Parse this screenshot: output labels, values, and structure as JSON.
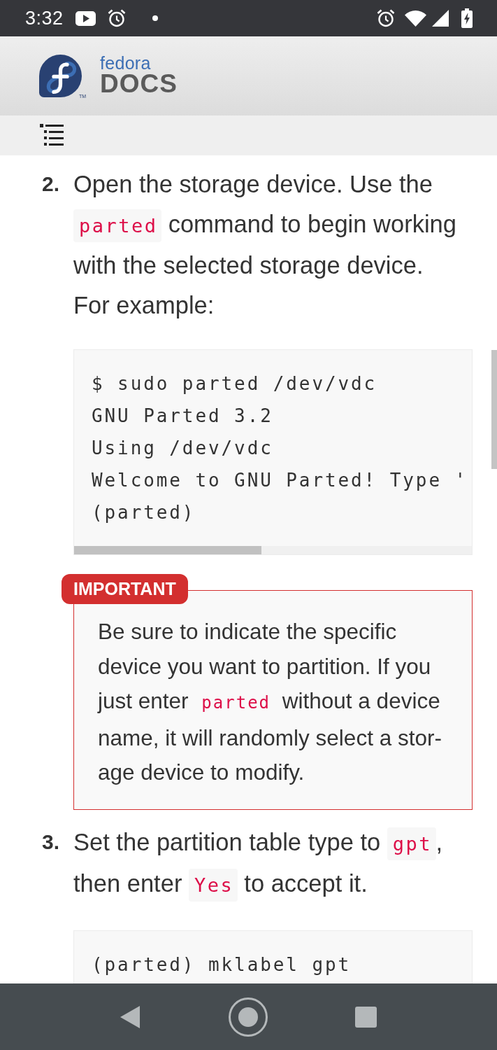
{
  "status_bar": {
    "time": "3:32"
  },
  "header": {
    "logo_wordmark": "fedora",
    "logo_title": "DOCS",
    "trademark": "TM"
  },
  "steps": [
    {
      "number": "2.",
      "text": [
        {
          "kind": "text",
          "value": "Open the storage device. Use the "
        },
        {
          "kind": "code",
          "value": "parted"
        },
        {
          "kind": "text",
          "value": " command to begin working with the selected storage device. For example:"
        }
      ],
      "code_block": {
        "lines": [
          "$ sudo parted /dev/vdc",
          "GNU Parted 3.2",
          "Using /dev/vdc",
          "Welcome to GNU Parted! Type '",
          "(parted)"
        ],
        "scrollbar": true
      },
      "admonition": {
        "kind": "important",
        "label": "IMPORTANT",
        "text": [
          {
            "kind": "text",
            "value": "Be sure to indicate the specific device you want to partition. If you just enter "
          },
          {
            "kind": "code",
            "value": "parted"
          },
          {
            "kind": "text",
            "value": " without a device name, it will randomly select a stor-age device to modify."
          }
        ]
      }
    },
    {
      "number": "3.",
      "text": [
        {
          "kind": "text",
          "value": "Set the partition table type to "
        },
        {
          "kind": "code",
          "value": "gpt"
        },
        {
          "kind": "text",
          "value": ", then enter "
        },
        {
          "kind": "code",
          "value": "Yes"
        },
        {
          "kind": "text",
          "value": " to accept it."
        }
      ],
      "code_block": {
        "lines": [
          "(parted) mklabel gpt"
        ],
        "scrollbar": false
      }
    }
  ]
}
